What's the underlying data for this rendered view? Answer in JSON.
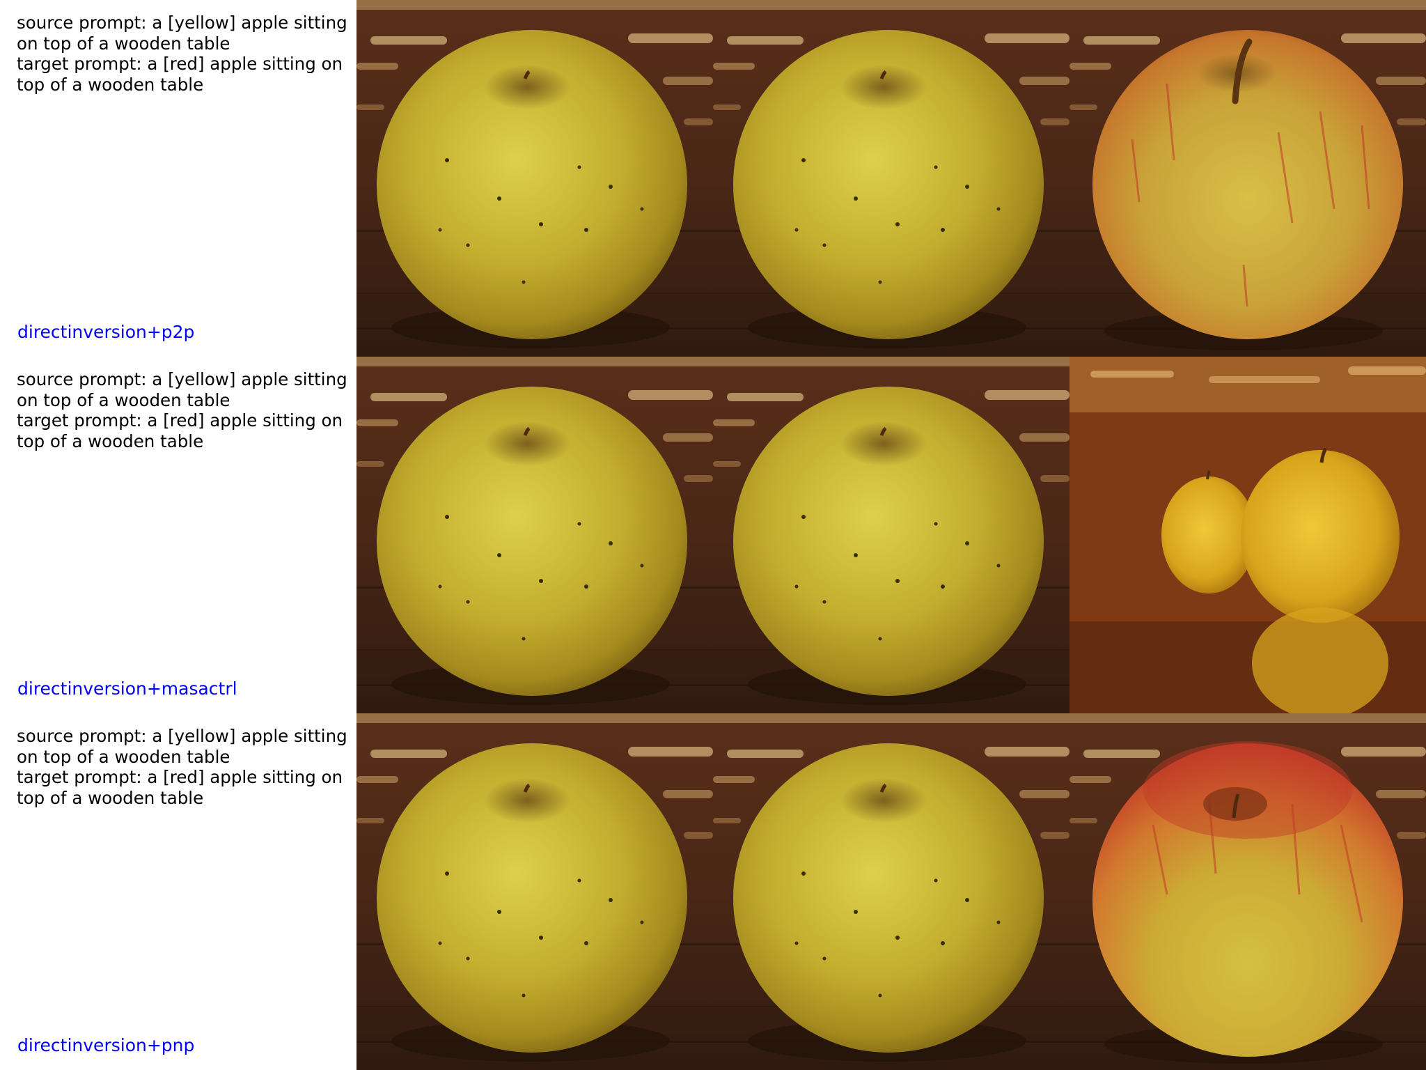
{
  "rows": [
    {
      "source_prompt": "source prompt: a [yellow] apple sitting on top of a wooden table",
      "target_prompt": "target prompt: a [red] apple sitting on top of a wooden table",
      "method": "directinversion+p2p",
      "tiles": [
        {
          "content": "yellow-apple-single",
          "apple_count": 1,
          "apple_color": "#c9b42f"
        },
        {
          "content": "yellow-apple-single",
          "apple_count": 1,
          "apple_color": "#c9b42f"
        },
        {
          "content": "red-yellow-apple-single",
          "apple_count": 1,
          "apple_color": "#d1a233"
        }
      ]
    },
    {
      "source_prompt": "source prompt: a [yellow] apple sitting on top of a wooden table",
      "target_prompt": "target prompt: a [red] apple sitting on top of a wooden table",
      "method": "directinversion+masactrl",
      "tiles": [
        {
          "content": "yellow-apple-single",
          "apple_count": 1,
          "apple_color": "#c9b42f"
        },
        {
          "content": "yellow-apple-single",
          "apple_count": 1,
          "apple_color": "#c9b42f"
        },
        {
          "content": "two-yellow-apples-with-reflection",
          "apple_count": 2,
          "apple_color": "#e0ad1d"
        }
      ]
    },
    {
      "source_prompt": "source prompt: a [yellow] apple sitting on top of a wooden table",
      "target_prompt": "target prompt: a [red] apple sitting on top of a wooden table",
      "method": "directinversion+pnp",
      "tiles": [
        {
          "content": "yellow-apple-single",
          "apple_count": 1,
          "apple_color": "#c9b42f"
        },
        {
          "content": "yellow-apple-single",
          "apple_count": 1,
          "apple_color": "#c9b42f"
        },
        {
          "content": "red-top-apple-single",
          "apple_count": 1,
          "apple_color": "#d5882c"
        }
      ]
    }
  ],
  "colors": {
    "prompt_text": "#000000",
    "method_label": "#0000ff",
    "background": "#ffffff",
    "wood_dark": "#3e2214",
    "wood_light": "#c9a56a"
  }
}
